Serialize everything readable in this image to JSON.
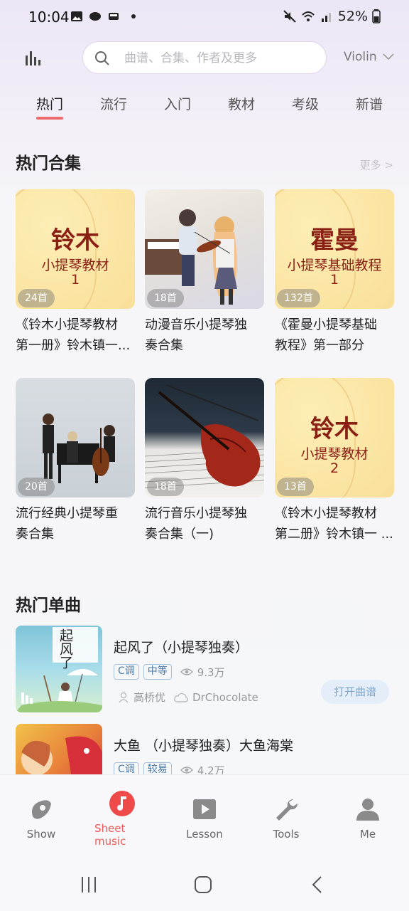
{
  "status_bar": {
    "time": "10:04",
    "battery": "52%"
  },
  "header": {
    "search_placeholder": "曲谱、合集、作者及更多",
    "instrument": "Violin"
  },
  "tabs": [
    {
      "label": "热门",
      "active": true
    },
    {
      "label": "流行"
    },
    {
      "label": "入门"
    },
    {
      "label": "教材"
    },
    {
      "label": "考级"
    },
    {
      "label": "新谱"
    }
  ],
  "hot_collections": {
    "title": "热门合集",
    "more": "更多 >",
    "items": [
      {
        "count": "24首",
        "title_line1": "《铃木小提琴教材",
        "title_line2": "第一册》铃木镇一...",
        "cover": {
          "big": "铃木",
          "sub": "小提琴教材",
          "num": "1"
        }
      },
      {
        "count": "18首",
        "title_line1": "动漫音乐小提琴独",
        "title_line2": "奏合集"
      },
      {
        "count": "132首",
        "title_line1": "《霍曼小提琴基础",
        "title_line2": "教程》第一部分",
        "cover": {
          "big": "霍曼",
          "sub": "小提琴基础教程",
          "num": "1"
        }
      },
      {
        "count": "20首",
        "title_line1": "流行经典小提琴重",
        "title_line2": "奏合集"
      },
      {
        "count": "18首",
        "title_line1": "流行音乐小提琴独",
        "title_line2": "奏合集（一)"
      },
      {
        "count": "13首",
        "title_line1": "《铃木小提琴教材",
        "title_line2": "第二册》铃木镇一 ...",
        "cover": {
          "big": "铃木",
          "sub": "小提琴教材",
          "num": "2"
        }
      }
    ]
  },
  "hot_singles": {
    "title": "热门单曲",
    "items": [
      {
        "title": "起风了（小提琴独奏）",
        "key": "C调",
        "level": "中等",
        "views": "9.3万",
        "author": "高桥优",
        "uploader": "DrChocolate",
        "action": "打开曲谱",
        "cover_text": "起风了"
      },
      {
        "title": "大鱼 （小提琴独奏）大鱼海棠",
        "key": "C调",
        "level": "较易",
        "views": "4.2万"
      }
    ]
  },
  "bottom_nav": [
    {
      "label": "Show"
    },
    {
      "label_line1": "Sheet",
      "label_line2": "music",
      "active": true
    },
    {
      "label": "Lesson"
    },
    {
      "label": "Tools"
    },
    {
      "label": "Me"
    }
  ],
  "colors": {
    "accent": "#ef5a5a",
    "book_text": "#8a1f14",
    "tag_blue": "#4a7aa6"
  }
}
